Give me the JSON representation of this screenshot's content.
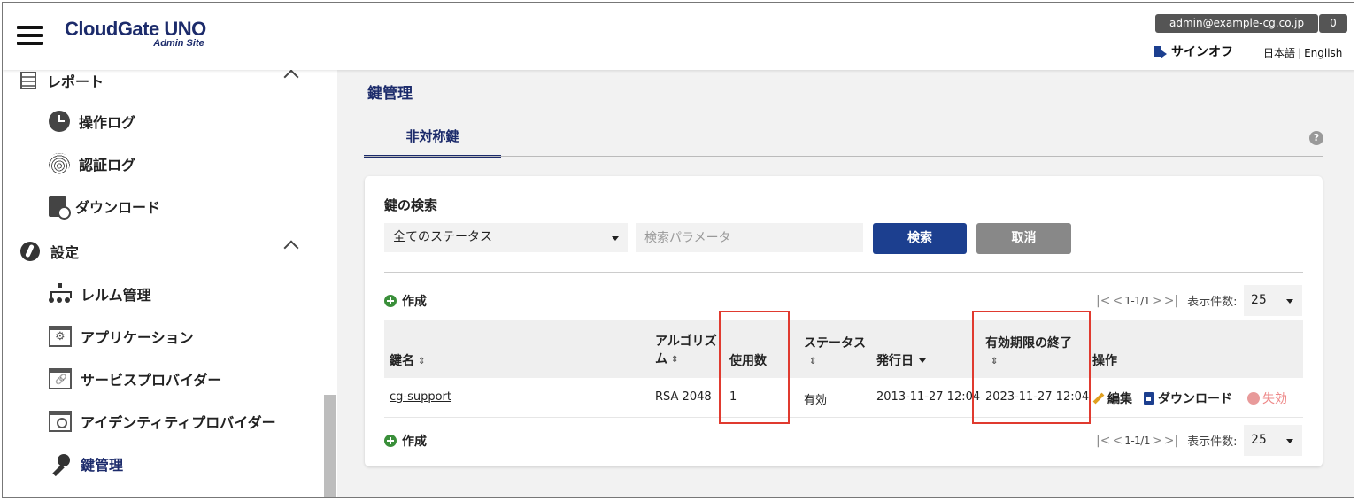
{
  "header": {
    "logo_main": "CloudGate UNO",
    "logo_sub": "Admin Site",
    "user_email": "admin@example-cg.co.jp",
    "notification_count": "0",
    "signoff_label": "サインオフ",
    "lang_ja": "日本語",
    "lang_sep": "|",
    "lang_en": "English"
  },
  "sidebar": {
    "report_section": "レポート",
    "report_items": [
      "操作ログ",
      "認証ログ",
      "ダウンロード"
    ],
    "settings_section": "設定",
    "settings_items": [
      "レルム管理",
      "アプリケーション",
      "サービスプロバイダー",
      "アイデンティティプロバイダー",
      "鍵管理"
    ],
    "active_item": "鍵管理"
  },
  "main": {
    "page_title": "鍵管理",
    "tab_label": "非対称鍵",
    "help_icon": "?",
    "search": {
      "title": "鍵の検索",
      "status_selected": "全てのステータス",
      "param_placeholder": "検索パラメータ",
      "search_button": "検索",
      "cancel_button": "取消"
    },
    "create_label": "作成",
    "pager": {
      "range": "1-1/1",
      "per_page_label": "表示件数:",
      "per_page_value": "25"
    },
    "table": {
      "columns": {
        "key_name": "鍵名",
        "algorithm_line1": "アルゴリズ",
        "algorithm_line2": "ム",
        "usage_count": "使用数",
        "status": "ステータス",
        "issued_date": "発行日",
        "expiry": "有効期限の終了",
        "actions": "操作"
      },
      "rows": [
        {
          "key_name": "cg-support",
          "algorithm": "RSA 2048",
          "usage_count": "1",
          "status": "有効",
          "issued_date": "2013-11-27 12:04",
          "expiry": "2023-11-27 12:04",
          "action_edit": "編集",
          "action_download": "ダウンロード",
          "action_disable": "失効"
        }
      ]
    }
  },
  "colors": {
    "brand_navy": "#1c2b6b",
    "primary_button": "#1c3f8f",
    "highlight_red": "#e03a2f",
    "create_green": "#3a8f3a"
  }
}
